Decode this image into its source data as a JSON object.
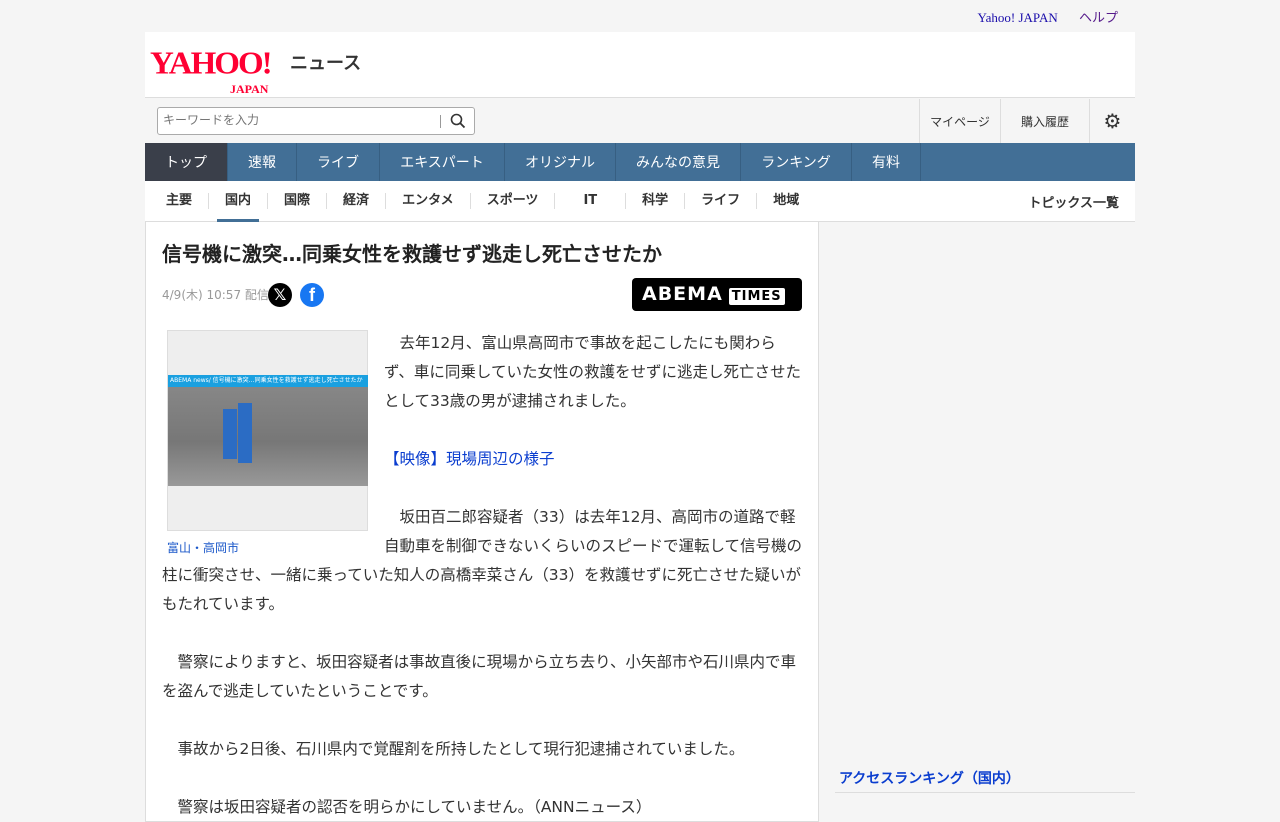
{
  "topbar": {
    "yahoo_japan": "Yahoo! JAPAN",
    "help": "ヘルプ"
  },
  "logo": {
    "brand": "YAHOO!",
    "sub": "JAPAN",
    "section": "ニュース"
  },
  "search": {
    "placeholder": "キーワードを入力",
    "mypage": "マイページ",
    "history": "購入履歴"
  },
  "global_nav": [
    "トップ",
    "速報",
    "ライブ",
    "エキスパート",
    "オリジナル",
    "みんなの意見",
    "ランキング",
    "有料"
  ],
  "sub_nav": [
    "主要",
    "国内",
    "国際",
    "経済",
    "エンタメ",
    "スポーツ",
    "IT",
    "科学",
    "ライフ",
    "地域"
  ],
  "sub_nav_all": "トピックス一覧",
  "article": {
    "title": "信号機に激突…同乗女性を救護せず逃走し死亡させたか",
    "date": "4/9(木) 10:57 配信",
    "source": "ABEMA",
    "source_badge": "TIMES",
    "photo_banner": "ABEMA news/ 信号機に激突…同乗女性を救護せず逃走し死亡させたか",
    "photo_caption": "富山・高岡市",
    "p1": "　去年12月、富山県高岡市で事故を起こしたにも関わらず、車に同乗していた女性の救護をせずに逃走し死亡させたとして33歳の男が逮捕されました。",
    "link": "【映像】現場周辺の様子",
    "p2": "　坂田百二郎容疑者（33）は去年12月、高岡市の道路で軽自動車を制御できないくらいのスピードで運転して信号機の柱に衝突させ、一緒に乗っていた知人の高橋幸菜さん（33）を救護せずに死亡させた疑いがもたれています。",
    "p3": "　警察によりますと、坂田容疑者は事故直後に現場から立ち去り、小矢部市や石川県内で車を盗んで逃走していたということです。",
    "p4": "　事故から2日後、石川県内で覚醒剤を所持したとして現行犯逮捕されていました。",
    "p5": "　警察は坂田容疑者の認否を明らかにしていません。（ANNニュース）"
  },
  "sidebar": {
    "ranking_title": "アクセスランキング（国内）"
  }
}
